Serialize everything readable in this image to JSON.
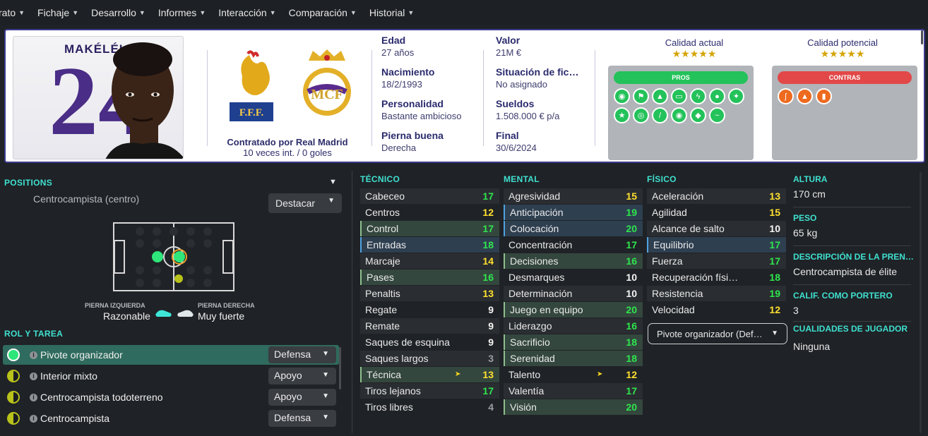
{
  "menu": [
    "rato",
    "Fichaje",
    "Desarrollo",
    "Informes",
    "Interacción",
    "Comparación",
    "Historial"
  ],
  "player": {
    "shirt_name": "MAKÉLÉL",
    "shirt_number": "24",
    "contract_line1": "Contratado por Real Madrid",
    "contract_line2": "10 veces int. / 0 goles"
  },
  "info": {
    "age_label": "Edad",
    "age": "27 años",
    "birth_label": "Nacimiento",
    "birth": "18/2/1993",
    "personality_label": "Personalidad",
    "personality": "Bastante ambicioso",
    "foot_label": "Pierna buena",
    "foot": "Derecha",
    "value_label": "Valor",
    "value": "21M €",
    "situation_label": "Situación de fic…",
    "situation": "No asignado",
    "wage_label": "Sueldos",
    "wage": "1.508.000 € p/a",
    "end_label": "Final",
    "end": "30/6/2024"
  },
  "quality": {
    "current_label": "Calidad actual",
    "current_stars": "★★★★★",
    "potential_label": "Calidad potencial",
    "potential_stars": "★★★★★",
    "pros_label": "PROS",
    "cons_label": "CONTRAS"
  },
  "positions": {
    "title": "POSITIONS",
    "position": "Centrocampista (centro)",
    "highlight": "Destacar",
    "left_foot_label": "PIERNA IZQUIERDA",
    "left_foot": "Razonable",
    "right_foot_label": "PIERNA DERECHA",
    "right_foot": "Muy fuerte"
  },
  "roles": {
    "title": "ROL Y TAREA",
    "items": [
      {
        "name": "Pivote organizador",
        "duty": "Defensa"
      },
      {
        "name": "Interior mixto",
        "duty": "Apoyo"
      },
      {
        "name": "Centrocampista todoterreno",
        "duty": "Apoyo"
      },
      {
        "name": "Centrocampista",
        "duty": "Defensa"
      }
    ]
  },
  "tecnico": {
    "title": "TÉCNICO",
    "items": [
      {
        "name": "Cabeceo",
        "value": "17"
      },
      {
        "name": "Centros",
        "value": "12"
      },
      {
        "name": "Control",
        "value": "17"
      },
      {
        "name": "Entradas",
        "value": "18"
      },
      {
        "name": "Marcaje",
        "value": "14"
      },
      {
        "name": "Pases",
        "value": "16"
      },
      {
        "name": "Penaltis",
        "value": "13"
      },
      {
        "name": "Regate",
        "value": "9"
      },
      {
        "name": "Remate",
        "value": "9"
      },
      {
        "name": "Saques de esquina",
        "value": "9"
      },
      {
        "name": "Saques largos",
        "value": "3"
      },
      {
        "name": "Técnica",
        "value": "13"
      },
      {
        "name": "Tiros lejanos",
        "value": "17"
      },
      {
        "name": "Tiros libres",
        "value": "4"
      }
    ]
  },
  "mental": {
    "title": "MENTAL",
    "items": [
      {
        "name": "Agresividad",
        "value": "15"
      },
      {
        "name": "Anticipación",
        "value": "19"
      },
      {
        "name": "Colocación",
        "value": "20"
      },
      {
        "name": "Concentración",
        "value": "17"
      },
      {
        "name": "Decisiones",
        "value": "16"
      },
      {
        "name": "Desmarques",
        "value": "10"
      },
      {
        "name": "Determinación",
        "value": "10"
      },
      {
        "name": "Juego en equipo",
        "value": "20"
      },
      {
        "name": "Liderazgo",
        "value": "16"
      },
      {
        "name": "Sacrificio",
        "value": "18"
      },
      {
        "name": "Serenidad",
        "value": "18"
      },
      {
        "name": "Talento",
        "value": "12"
      },
      {
        "name": "Valentía",
        "value": "17"
      },
      {
        "name": "Visión",
        "value": "20"
      }
    ]
  },
  "fisico": {
    "title": "FÍSICO",
    "items": [
      {
        "name": "Aceleración",
        "value": "13"
      },
      {
        "name": "Agilidad",
        "value": "15"
      },
      {
        "name": "Alcance de salto",
        "value": "10"
      },
      {
        "name": "Equilibrio",
        "value": "17"
      },
      {
        "name": "Fuerza",
        "value": "17"
      },
      {
        "name": "Recuperación físi…",
        "value": "18"
      },
      {
        "name": "Resistencia",
        "value": "19"
      },
      {
        "name": "Velocidad",
        "value": "12"
      }
    ],
    "role_select": "Pivote organizador (Def…"
  },
  "details": {
    "height_label": "ALTURA",
    "height": "170 cm",
    "weight_label": "PESO",
    "weight": "65 kg",
    "desc_label": "DESCRIPCIÓN DE LA PREN…",
    "desc": "Centrocampista de élite",
    "gk_label": "CALIF. COMO PORTERO",
    "gk": "3",
    "traits_label": "CUALIDADES DE JUGADOR",
    "traits": "Ninguna"
  },
  "colors": {
    "accent": "#3fe0d0",
    "high": "#2ee64e",
    "mid": "#ffe02e",
    "card_border": "#3b3b8f"
  }
}
